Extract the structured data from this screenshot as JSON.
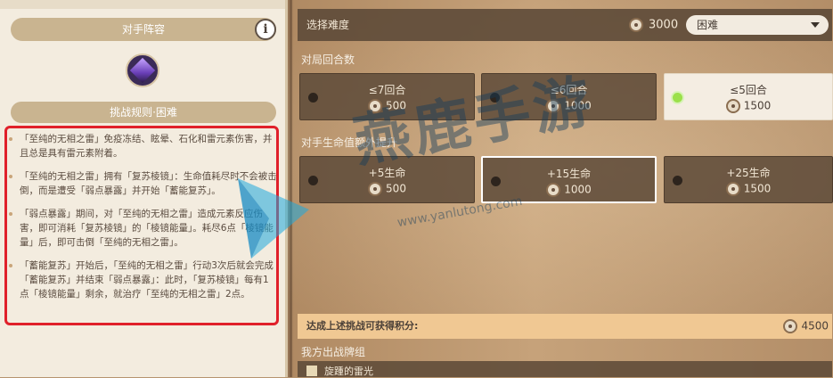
{
  "opponent": {
    "header": "对手阵容",
    "info_icon": "i",
    "avatar_icon": "electro-boss-icon"
  },
  "rules": {
    "header": "挑战规则·困难",
    "items": [
      "「至纯的无相之雷」免疫冻结、眩晕、石化和雷元素伤害，并且总是具有雷元素附着。",
      "「至纯的无相之雷」拥有「复苏棱镜」：生命值耗尽时不会被击倒，而是遭受「弱点暴露」并开始「蓄能复苏」。",
      "「弱点暴露」期间，对「至纯的无相之雷」造成元素反应伤害，即可消耗「复苏棱镜」的「棱镜能量」。耗尽6点「棱镜能量」后，即可击倒「至纯的无相之雷」。",
      "「蓄能复苏」开始后，「至纯的无相之雷」行动3次后就会完成「蓄能复苏」并结束「弱点暴露」：此时，「复苏棱镜」每有1点「棱镜能量」剩余，就治疗「至纯的无相之雷」2点。"
    ]
  },
  "difficulty": {
    "label": "选择难度",
    "cost": "3000",
    "selected": "困难"
  },
  "rounds": {
    "title": "对局回合数",
    "options": [
      {
        "label": "≤7回合",
        "points": "500"
      },
      {
        "label": "≤6回合",
        "points": "1000"
      },
      {
        "label": "≤5回合",
        "points": "1500"
      }
    ]
  },
  "hp": {
    "title": "对手生命值额外提升",
    "options": [
      {
        "label": "+5生命",
        "points": "500"
      },
      {
        "label": "+15生命",
        "points": "1000"
      },
      {
        "label": "+25生命",
        "points": "1500"
      }
    ]
  },
  "score": {
    "label": "达成上述挑战可获得积分:",
    "value": "4500"
  },
  "deck": {
    "title": "我方出战牌组",
    "name": "旋踵的雷光"
  },
  "watermark": {
    "text": "燕鹿手游",
    "url": "www.yanlutong.com"
  },
  "colors": {
    "accent_red": "#e0202a",
    "selected_green": "#9be04a",
    "score_bar": "#f0c893"
  }
}
